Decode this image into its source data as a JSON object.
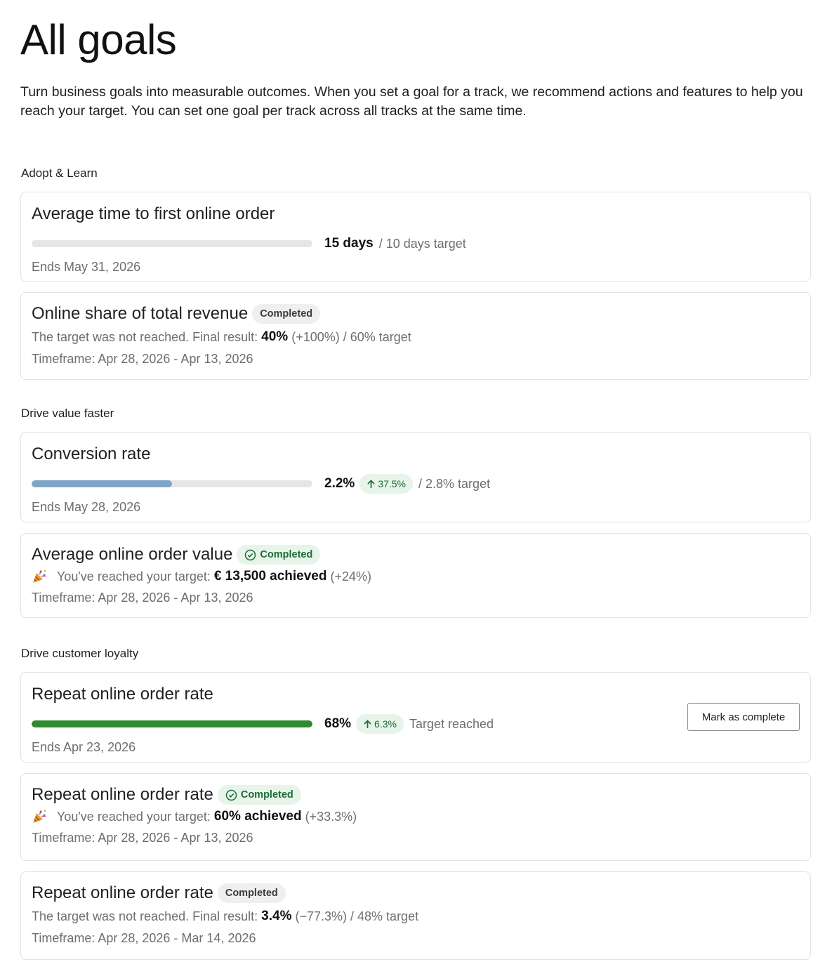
{
  "page": {
    "title": "All goals",
    "intro": "Turn business goals into measurable outcomes. When you set a goal for a track, we recommend actions and features to help you reach your target. You can set one goal per track across all tracks at the same time."
  },
  "colors": {
    "progress_blue": "#7fa6c8",
    "progress_green": "#2e8b2e",
    "track_grey": "#e6e6e6",
    "success_badge_bg": "#e6f4ea",
    "success_badge_text": "#1d6b36",
    "neutral_badge_bg": "#efefef"
  },
  "groups": [
    {
      "title": "Adopt & Learn",
      "goals": [
        {
          "title": "Average time to first online order",
          "progress_fraction": 0,
          "value": "15 days",
          "after": "/ 10 days target",
          "meta": "Ends May 31, 2026"
        },
        {
          "title": "Online share of total revenue",
          "badge": "Completed",
          "result_prefix": "The target was not reached. Final result:",
          "result_value": "40%",
          "result_suffix": "(+100%) / 60% target",
          "meta": "Timeframe: Apr 28, 2026 - Apr 13, 2026"
        }
      ]
    },
    {
      "title": "Drive value faster",
      "goals": [
        {
          "title": "Conversion rate",
          "progress_fraction": 0.5,
          "value": "2.2%",
          "delta": "37.5%",
          "after": "/ 2.8% target",
          "meta": "Ends May 28, 2026"
        },
        {
          "title": "Average online order value",
          "badge": "Completed",
          "result_prefix": "You've reached your target:",
          "result_value": "€ 13,500 achieved",
          "result_suffix": "(+24%)",
          "meta": "Timeframe: Apr 28, 2026 - Apr 13, 2026",
          "icons": [
            "party-popper-icon",
            "check-circle-icon"
          ]
        }
      ]
    },
    {
      "title": "Drive customer loyalty",
      "goals": [
        {
          "title": "Repeat online order rate",
          "progress_fraction": 1,
          "value": "68%",
          "delta": "6.3%",
          "after": "Target reached",
          "meta": "Ends Apr 23, 2026",
          "action_label": "Mark as complete"
        },
        {
          "title": "Repeat online order rate",
          "badge": "Completed",
          "result_prefix": "You've reached your target:",
          "result_value": "60% achieved",
          "result_suffix": "(+33.3%)",
          "meta": "Timeframe: Apr 28, 2026 - Apr 13, 2026",
          "icons": [
            "party-popper-icon",
            "check-circle-icon"
          ]
        },
        {
          "title": "Repeat online order rate",
          "badge": "Completed",
          "result_prefix": "The target was not reached. Final result:",
          "result_value": "3.4%",
          "result_suffix": "(−77.3%) / 48% target",
          "meta": "Timeframe: Apr 28, 2026 - Mar 14, 2026"
        }
      ]
    }
  ]
}
